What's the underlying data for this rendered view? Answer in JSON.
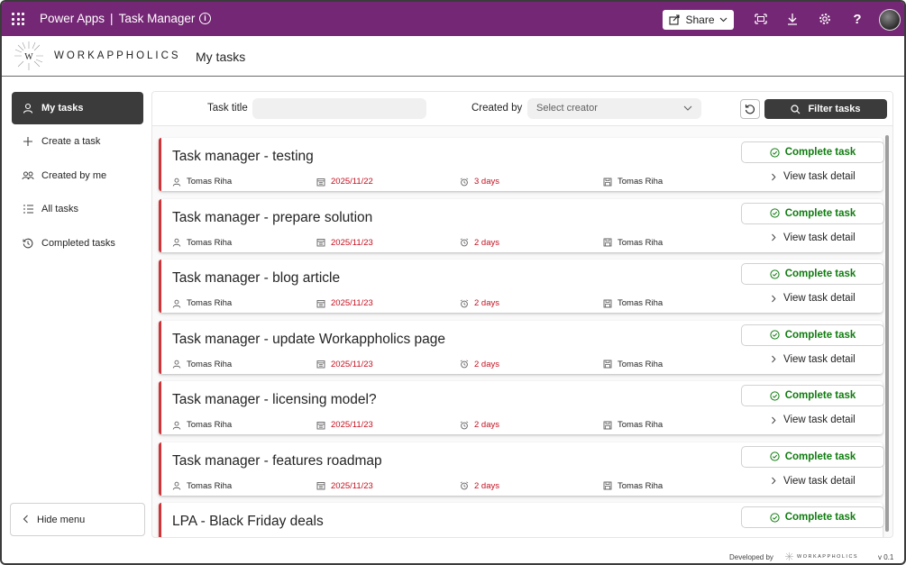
{
  "topbar": {
    "product": "Power Apps",
    "separator": "|",
    "app_name": "Task Manager",
    "share_label": "Share",
    "accent": "#742774"
  },
  "header": {
    "logo_text": "WORKAPPHOLICS",
    "logo_letter": "W",
    "page_title": "My tasks"
  },
  "sidebar": {
    "items": [
      {
        "label": "My tasks",
        "icon": "person-icon",
        "active": true
      },
      {
        "label": "Create a task",
        "icon": "plus-icon",
        "active": false
      },
      {
        "label": "Created by me",
        "icon": "people-icon",
        "active": false
      },
      {
        "label": "All tasks",
        "icon": "list-icon",
        "active": false
      },
      {
        "label": "Completed tasks",
        "icon": "history-icon",
        "active": false
      }
    ],
    "hide_menu_label": "Hide menu"
  },
  "filters": {
    "task_title_label": "Task title",
    "task_title_value": "",
    "created_by_label": "Created by",
    "created_by_placeholder": "Select creator",
    "filter_button_label": "Filter tasks"
  },
  "tasks": [
    {
      "title": "Task manager - testing",
      "assignee": "Tomas Riha",
      "due": "2025/11/22",
      "remaining": "3 days",
      "creator": "Tomas Riha"
    },
    {
      "title": "Task manager - prepare solution",
      "assignee": "Tomas Riha",
      "due": "2025/11/23",
      "remaining": "2 days",
      "creator": "Tomas Riha"
    },
    {
      "title": "Task manager - blog article",
      "assignee": "Tomas Riha",
      "due": "2025/11/23",
      "remaining": "2 days",
      "creator": "Tomas Riha"
    },
    {
      "title": "Task manager - update Workappholics page",
      "assignee": "Tomas Riha",
      "due": "2025/11/23",
      "remaining": "2 days",
      "creator": "Tomas Riha"
    },
    {
      "title": "Task manager - licensing model?",
      "assignee": "Tomas Riha",
      "due": "2025/11/23",
      "remaining": "2 days",
      "creator": "Tomas Riha"
    },
    {
      "title": "Task manager - features roadmap",
      "assignee": "Tomas Riha",
      "due": "2025/11/23",
      "remaining": "2 days",
      "creator": "Tomas Riha"
    },
    {
      "title": "LPA - Black Friday deals",
      "assignee": "",
      "due": "",
      "remaining": "",
      "creator": ""
    }
  ],
  "task_actions": {
    "complete_label": "Complete task",
    "view_detail_label": "View task detail"
  },
  "footer": {
    "developed_by": "Developed by",
    "logo_text": "WORKAPPHOLICS",
    "version": "v 0.1"
  },
  "colors": {
    "overdue_red": "#c50f1f",
    "card_accent": "#d13438",
    "complete_green": "#107c10",
    "nav_active": "#3b3b3b"
  }
}
